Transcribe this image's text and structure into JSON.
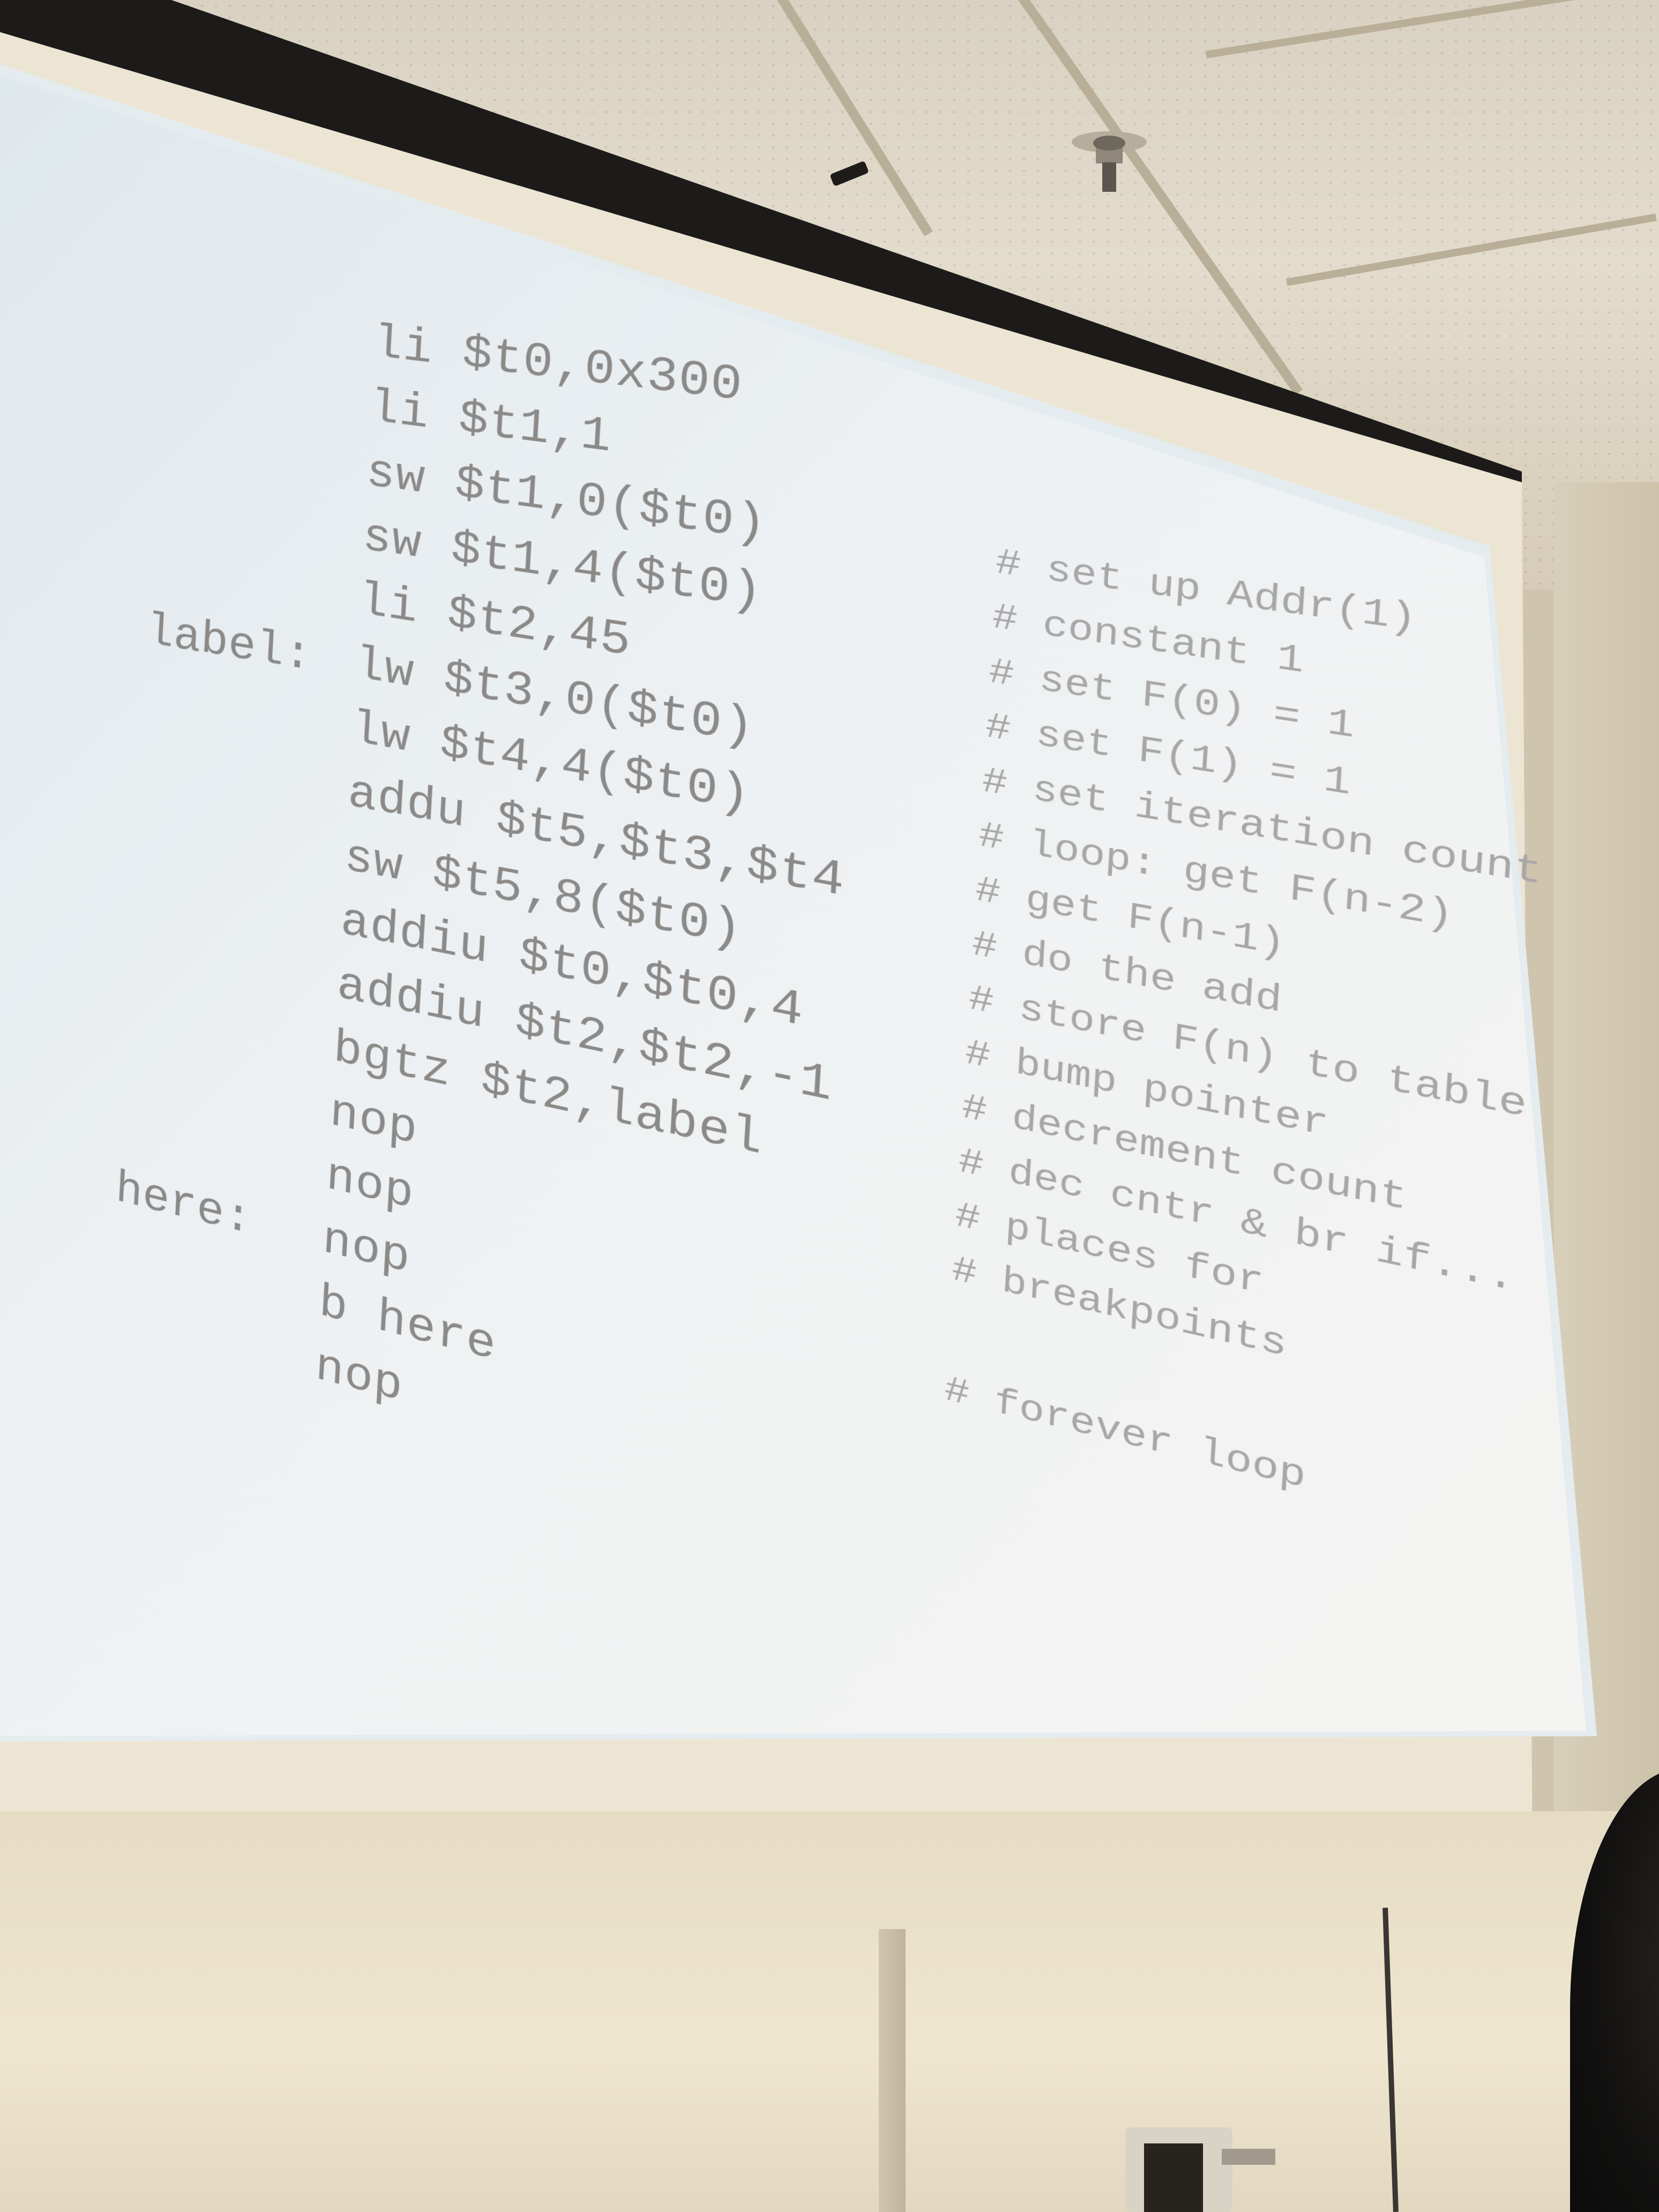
{
  "scene": {
    "description_tags": [
      "lecture-hall",
      "projector-screen",
      "slide"
    ],
    "colors": {
      "screen": "#e8eef0",
      "code_text": "#8c8a88",
      "comment_text": "#a9a6a7",
      "ceiling": "#ddd5c5",
      "frame": "#2b2a28"
    }
  },
  "slide": {
    "code": [
      {
        "label": "",
        "instr": "li $t0,0x300"
      },
      {
        "label": "",
        "instr": "li $t1,1"
      },
      {
        "label": "",
        "instr": "sw $t1,0($t0)"
      },
      {
        "label": "",
        "instr": "sw $t1,4($t0)"
      },
      {
        "label": "",
        "instr": "li $t2,45"
      },
      {
        "label": "label:",
        "instr": "lw $t3,0($t0)"
      },
      {
        "label": "",
        "instr": "lw $t4,4($t0)"
      },
      {
        "label": "",
        "instr": "addu $t5,$t3,$t4"
      },
      {
        "label": "",
        "instr": "sw $t5,8($t0)"
      },
      {
        "label": "",
        "instr": "addiu $t0,$t0,4"
      },
      {
        "label": "",
        "instr": "addiu $t2,$t2,-1"
      },
      {
        "label": "",
        "instr": "bgtz $t2,label"
      },
      {
        "label": "",
        "instr": "nop"
      },
      {
        "label": "",
        "instr": "nop"
      },
      {
        "label": "here:",
        "instr": "nop"
      },
      {
        "label": "",
        "instr": "b here"
      },
      {
        "label": "",
        "instr": "nop"
      }
    ],
    "comments": [
      "# set up Addr(1)",
      "# constant 1",
      "# set F(0) = 1",
      "# set F(1) = 1",
      "# set iteration count",
      "# loop: get F(n-2)",
      "# get F(n-1)",
      "# do the add",
      "# store F(n) to table",
      "# bump pointer",
      "# decrement count",
      "# dec cntr & br if...",
      "# places for",
      "# breakpoints",
      "# forever loop"
    ]
  }
}
